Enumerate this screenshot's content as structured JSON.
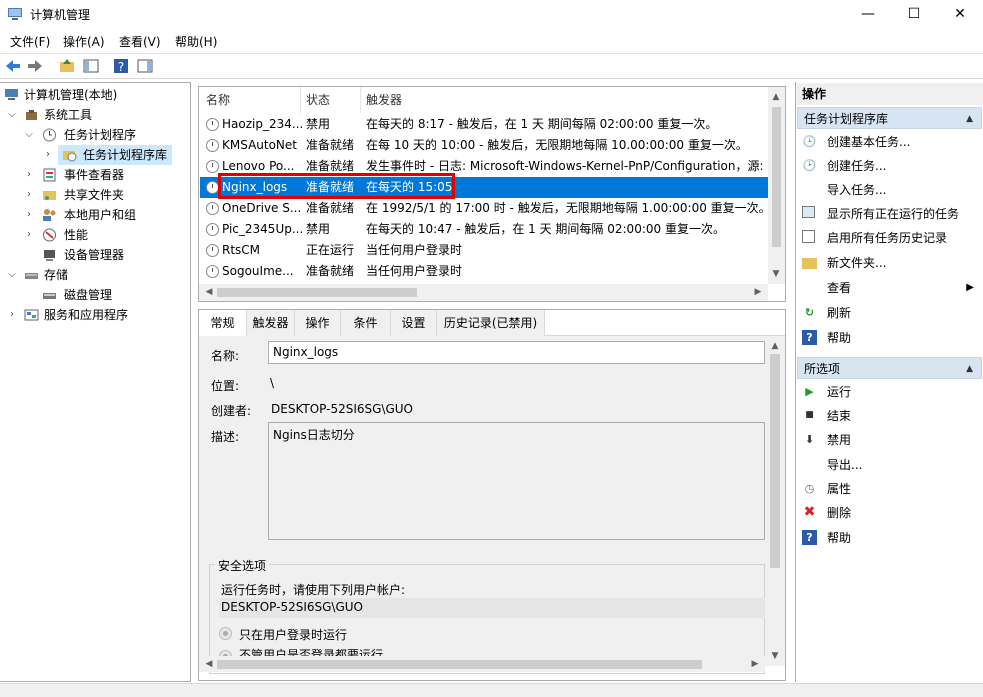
{
  "window": {
    "title": "计算机管理"
  },
  "menu": [
    "文件(F)",
    "操作(A)",
    "查看(V)",
    "帮助(H)"
  ],
  "tree": {
    "root": "计算机管理(本地)",
    "system_tools": "系统工具",
    "task_scheduler": "任务计划程序",
    "task_scheduler_library": "任务计划程序库",
    "event_viewer": "事件查看器",
    "shared_folders": "共享文件夹",
    "local_users": "本地用户和组",
    "performance": "性能",
    "device_manager": "设备管理器",
    "storage": "存储",
    "disk_management": "磁盘管理",
    "services_apps": "服务和应用程序"
  },
  "task_list": {
    "columns": [
      "名称",
      "状态",
      "触发器"
    ],
    "rows": [
      {
        "name": "Haozip_234...",
        "status": "禁用",
        "trigger": "在每天的 8:17 - 触发后，在 1 天 期间每隔 02:00:00 重复一次。"
      },
      {
        "name": "KMSAutoNet",
        "status": "准备就绪",
        "trigger": "在每 10 天的 10:00 - 触发后，无限期地每隔 10.00:00:00 重复一次。"
      },
      {
        "name": "Lenovo Po...",
        "status": "准备就绪",
        "trigger": "发生事件时 - 日志: Microsoft-Windows-Kernel-PnP/Configuration，源:"
      },
      {
        "name": "Nginx_logs",
        "status": "准备就绪",
        "trigger": "在每天的 15:05"
      },
      {
        "name": "OneDrive S...",
        "status": "准备就绪",
        "trigger": "在 1992/5/1 的 17:00 时 - 触发后，无限期地每隔 1.00:00:00 重复一次。"
      },
      {
        "name": "Pic_2345Up...",
        "status": "禁用",
        "trigger": "在每天的 10:47 - 触发后，在 1 天 期间每隔 02:00:00 重复一次。"
      },
      {
        "name": "RtsCM",
        "status": "正在运行",
        "trigger": "当任何用户登录时"
      },
      {
        "name": "SogouIme...",
        "status": "准备就绪",
        "trigger": "当任何用户登录时"
      }
    ],
    "selected_index": 3
  },
  "detail": {
    "tabs": [
      "常规",
      "触发器",
      "操作",
      "条件",
      "设置",
      "历史记录(已禁用)"
    ],
    "name_label": "名称:",
    "name_value": "Nginx_logs",
    "location_label": "位置:",
    "location_value": "\\",
    "author_label": "创建者:",
    "author_value": "DESKTOP-52SI6SG\\GUO",
    "desc_label": "描述:",
    "desc_value": "Ngins日志切分",
    "security_group": "安全选项",
    "run_as_label": "运行任务时，请使用下列用户帐户:",
    "run_as_value": "DESKTOP-52SI6SG\\GUO",
    "radio1": "只在用户登录时运行",
    "radio2": "不管用户是否登录都要运行"
  },
  "actions": {
    "header": "操作",
    "section1": "任务计划程序库",
    "items1": [
      "创建基本任务...",
      "创建任务...",
      "导入任务...",
      "显示所有正在运行的任务",
      "启用所有任务历史记录",
      "新文件夹...",
      "查看",
      "刷新",
      "帮助"
    ],
    "section2": "所选项",
    "items2": [
      "运行",
      "结束",
      "禁用",
      "导出...",
      "属性",
      "删除",
      "帮助"
    ]
  },
  "colors": {
    "selection": "#0078d7",
    "highlight_border": "#e00000",
    "section_bg": "#d7e4f2"
  }
}
